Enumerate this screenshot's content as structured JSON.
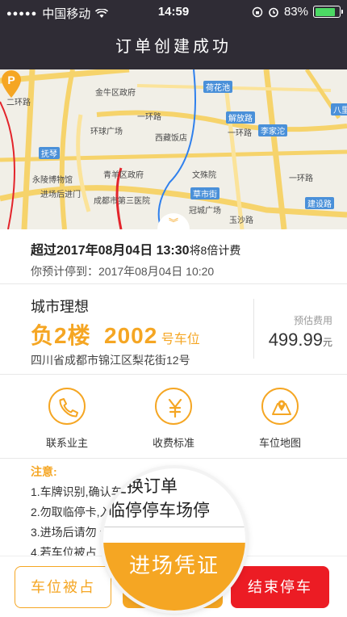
{
  "status_bar": {
    "carrier": "中国移动",
    "time": "14:59",
    "battery": "83%",
    "battery_level": 0.83
  },
  "nav": {
    "title": "订单创建成功"
  },
  "map": {
    "labels": [
      "金牛区政府",
      "一环路",
      "环球广场",
      "西藏饭店",
      "荷花池",
      "解放路",
      "李家沱",
      "抚琴",
      "青羊区政府",
      "文殊院",
      "永陵博物馆",
      "进场后进门",
      "草市街",
      "成都市第三医院",
      "冠城广场",
      "建设路",
      "玉沙路",
      "一环路",
      "一环路",
      "二环路",
      "八里"
    ],
    "pin_letter": "P"
  },
  "time_info": {
    "line1_prefix": "超过2017年08月04日 13:30",
    "line1_suffix": "将8倍计费",
    "line2": "你预计停到：2017年08月04日 10:20"
  },
  "spot": {
    "name": "城市理想",
    "floor": "负2楼",
    "number": "2002",
    "number_suffix": "号车位",
    "address": "四川省成都市锦江区梨花街12号",
    "fee_label": "预估费用",
    "fee_value": "499.99",
    "fee_unit": "元"
  },
  "actions": [
    {
      "label": "联系业主",
      "icon": "phone-icon"
    },
    {
      "label": "收费标准",
      "icon": "yen-icon"
    },
    {
      "label": "车位地图",
      "icon": "map-location-icon"
    }
  ],
  "notice": {
    "title": "注意:",
    "items": [
      "1.车牌识别,确认车牌更换订单为",
      "2.勿取临停卡,入临停停车场停放",
      "3.进场后请勿 停放他人车位后再离场",
      "4.若车位被占"
    ]
  },
  "magnifier": {
    "line1": "更换订单",
    "line2": "临停停车场停"
  },
  "bottom": {
    "occupied_label": "车位被占",
    "voucher_label": "进场凭证",
    "end_label": "结束停车"
  },
  "colors": {
    "accent": "#f5a623",
    "danger": "#ec1c24",
    "nav_bg": "#2f2c35"
  }
}
